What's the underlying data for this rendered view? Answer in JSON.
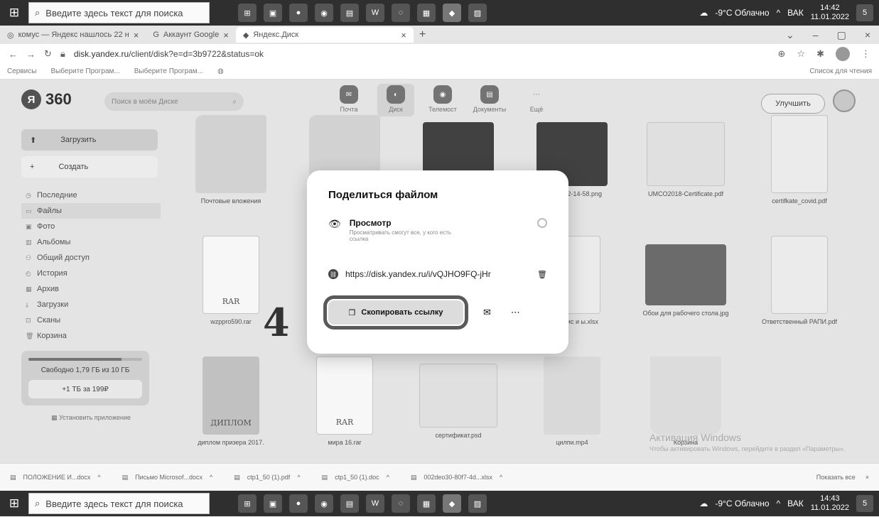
{
  "taskbar": {
    "search_placeholder": "Введите здесь текст для поиска",
    "apps": [
      "⊞",
      "▣",
      "●",
      "◉",
      "▤",
      "W",
      "◌",
      "▦",
      "◆",
      "▨"
    ],
    "weather": "-9°C Облачно",
    "lang": "ВАК",
    "top_time": "14:42",
    "top_date": "11.01.2022",
    "bottom_time": "14:43",
    "bottom_date": "11.01.2022",
    "notif_count": "5"
  },
  "tabs": [
    {
      "label": "комус — Яндекс нашлось 22 н"
    },
    {
      "label": "Аккаунт Google"
    },
    {
      "label": "Яндекс.Диск"
    }
  ],
  "address": {
    "url_prefix": "disk.yandex.ru",
    "url_rest": "/client/disk?e=d=3b9722&status=ok"
  },
  "bookmarks": {
    "items": [
      "Сервисы",
      "Выберите Програм...",
      "Выберите Програм...",
      ""
    ],
    "reading_list": "Список для чтения"
  },
  "header": {
    "logo_letter": "Я",
    "logo_text": "360",
    "search_placeholder": "Поиск в моём Диске",
    "services": [
      {
        "label": "Почта",
        "icon": "mail-icon"
      },
      {
        "label": "Диск",
        "icon": "disk-icon"
      },
      {
        "label": "Телемост",
        "icon": "telemost-icon"
      },
      {
        "label": "Документы",
        "icon": "documents-icon"
      },
      {
        "label": "Ещё",
        "icon": "more-icon"
      }
    ],
    "upgrade_label": "Улучшить"
  },
  "sidebar": {
    "upload_label": "Загрузить",
    "create_label": "Создать",
    "nav": [
      {
        "label": "Последние",
        "icon": "recent-icon"
      },
      {
        "label": "Файлы",
        "icon": "files-icon"
      },
      {
        "label": "Фото",
        "icon": "photo-icon"
      },
      {
        "label": "Альбомы",
        "icon": "albums-icon"
      },
      {
        "label": "Общий доступ",
        "icon": "shared-icon"
      },
      {
        "label": "История",
        "icon": "history-icon"
      },
      {
        "label": "Архив",
        "icon": "archive-icon"
      },
      {
        "label": "Загрузки",
        "icon": "downloads-icon"
      },
      {
        "label": "Сканы",
        "icon": "scans-icon"
      },
      {
        "label": "Корзина",
        "icon": "trash-icon"
      }
    ],
    "storage_text": "Свободно 1,79 ГБ из 10 ГБ",
    "storage_used_fraction": 0.82,
    "storage_button": "+1 ТБ за 199₽",
    "install_label": "Установить приложение"
  },
  "files": [
    {
      "name": "Почтовые вложения",
      "kind": "folder"
    },
    {
      "name": "",
      "kind": "folder"
    },
    {
      "name": "",
      "kind": "dark"
    },
    {
      "name": "hot from 2-14-58.png",
      "kind": "dark"
    },
    {
      "name": "UMCO2018-Certificate.pdf",
      "kind": "cert"
    },
    {
      "name": "certifkate_covid.pdf",
      "kind": "doc"
    },
    {
      "name": "wzppro590.rar",
      "kind": "rar",
      "thumb_label": "RAR"
    },
    {
      "name": "они офис и ы.xlsx",
      "kind": "doc"
    },
    {
      "name": "Обои для рабочего стола.jpg",
      "kind": "photo"
    },
    {
      "name": "Ответственный РАПИ.pdf",
      "kind": "doc"
    },
    {
      "name": "диплом призера 2017.",
      "kind": "book",
      "thumb_label": "ДИПЛОМ"
    },
    {
      "name": "мира 16.rar",
      "kind": "rar",
      "thumb_label": "RAR"
    },
    {
      "name": "сертификат.psd",
      "kind": "cert"
    },
    {
      "name": "цилпи.mp4",
      "kind": "video"
    },
    {
      "name": "Корзина",
      "kind": "trash"
    }
  ],
  "modal": {
    "title": "Поделиться файлом",
    "view_title": "Просмотр",
    "view_desc": "Просматривать смогут все, у кого есть ссылка",
    "link": "https://disk.yandex.ru/i/vQJHO9FQ-jHr",
    "copy_label": "Скопировать ссылку"
  },
  "annotation": "4",
  "activation": {
    "title": "Активация Windows",
    "subtitle": "Чтобы активировать Windows, перейдите в раздел «Параметры»."
  },
  "downloads": {
    "items": [
      "ПОЛОЖЕНИЕ И...docx",
      "Письмо Microsof...docx",
      "ctp1_50 (1).pdf",
      "ctp1_50 (1).doc",
      "002deo30-80f7-4d...xlsx"
    ],
    "show_all": "Показать все"
  }
}
